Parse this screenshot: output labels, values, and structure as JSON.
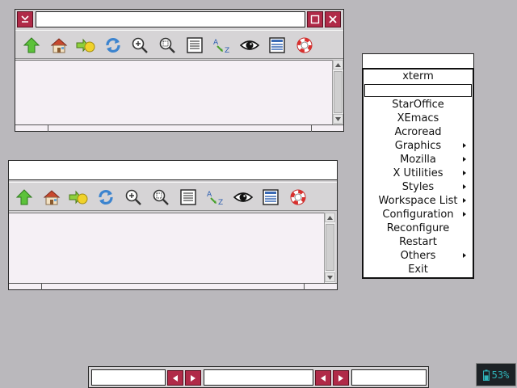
{
  "windows": [
    {
      "title": "",
      "toolbar": [
        "up-arrow-icon",
        "home-icon",
        "go-icon",
        "reload-icon",
        "zoom-in-icon",
        "zoom-fit-icon",
        "document-list-icon",
        "sort-az-icon",
        "eye-icon",
        "detail-list-icon",
        "help-lifebuoy-icon"
      ]
    },
    {
      "title": "",
      "toolbar": [
        "up-arrow-icon",
        "home-icon",
        "go-icon",
        "reload-icon",
        "zoom-in-icon",
        "zoom-fit-icon",
        "document-list-icon",
        "sort-az-icon",
        "eye-icon",
        "detail-list-icon",
        "help-lifebuoy-icon"
      ]
    }
  ],
  "root_menu": {
    "title": "",
    "items": [
      {
        "label": "xterm",
        "submenu": false
      },
      {
        "label": "",
        "separator": true
      },
      {
        "label": "StarOffice",
        "submenu": false
      },
      {
        "label": "XEmacs",
        "submenu": false
      },
      {
        "label": "Acroread",
        "submenu": false
      },
      {
        "label": "Graphics",
        "submenu": true
      },
      {
        "label": "Mozilla",
        "submenu": true
      },
      {
        "label": "X Utilities",
        "submenu": true
      },
      {
        "label": "Styles",
        "submenu": true
      },
      {
        "label": "Workspace List",
        "submenu": true
      },
      {
        "label": "Configuration",
        "submenu": true
      },
      {
        "label": "Reconfigure",
        "submenu": false
      },
      {
        "label": "Restart",
        "submenu": false
      },
      {
        "label": "Others",
        "submenu": true
      },
      {
        "label": "Exit",
        "submenu": false
      }
    ]
  },
  "taskbar": {
    "workspace_name": "",
    "window_name": "",
    "clock": ""
  },
  "battery": {
    "level_text": "53%",
    "level": 0.53
  },
  "colors": {
    "desktop": "#bab8bc",
    "accent_button": "#b02a48",
    "battery_text": "#2fb3b8"
  }
}
